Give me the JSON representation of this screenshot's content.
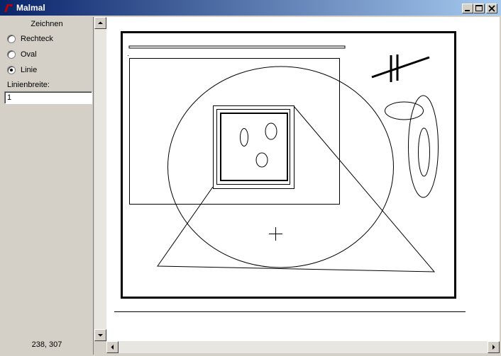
{
  "window": {
    "title": "Malmal"
  },
  "sidebar": {
    "group_title": "Zeichnen",
    "options": [
      {
        "label": "Rechteck",
        "checked": false
      },
      {
        "label": "Oval",
        "checked": false
      },
      {
        "label": "Linie",
        "checked": true
      }
    ],
    "linewidth_label": "Linienbreite:",
    "linewidth_value": "1",
    "coords": "238, 307"
  },
  "colors": {
    "titlebar_start": "#0a246a",
    "titlebar_end": "#a6caf0",
    "face": "#d4d0c8",
    "canvas": "#ffffff",
    "ink": "#000000"
  },
  "icons": {
    "app": "tk-feather-icon",
    "minimize": "minimize-icon",
    "maximize": "maximize-icon",
    "close": "close-icon"
  }
}
